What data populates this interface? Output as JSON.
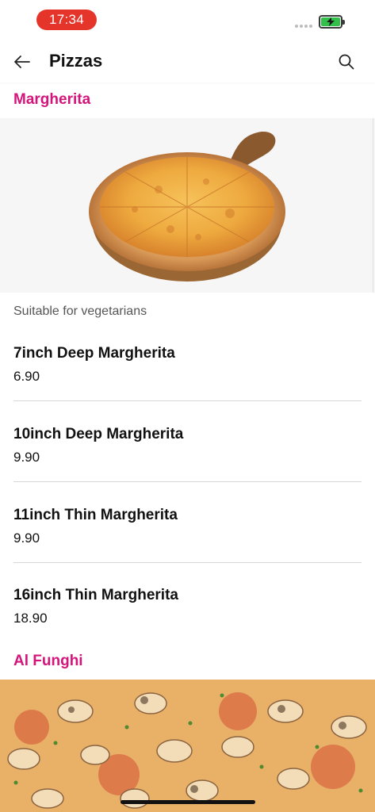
{
  "status_bar": {
    "time": "17:34",
    "time_pill_color": "#e5352b",
    "battery_icon": "battery-charging-icon"
  },
  "header": {
    "title": "Pizzas",
    "back_icon": "arrow-left-icon",
    "search_icon": "search-icon"
  },
  "accent_color": "#d5147b",
  "sections": [
    {
      "title": "Margherita",
      "note": "Suitable for vegetarians",
      "items": [
        {
          "name": "7inch Deep Margherita",
          "price": "6.90"
        },
        {
          "name": "10inch Deep Margherita",
          "price": "9.90"
        },
        {
          "name": "11inch Thin Margherita",
          "price": "9.90"
        },
        {
          "name": "16inch Thin Margherita",
          "price": "18.90"
        }
      ]
    },
    {
      "title": "Al Funghi"
    }
  ]
}
